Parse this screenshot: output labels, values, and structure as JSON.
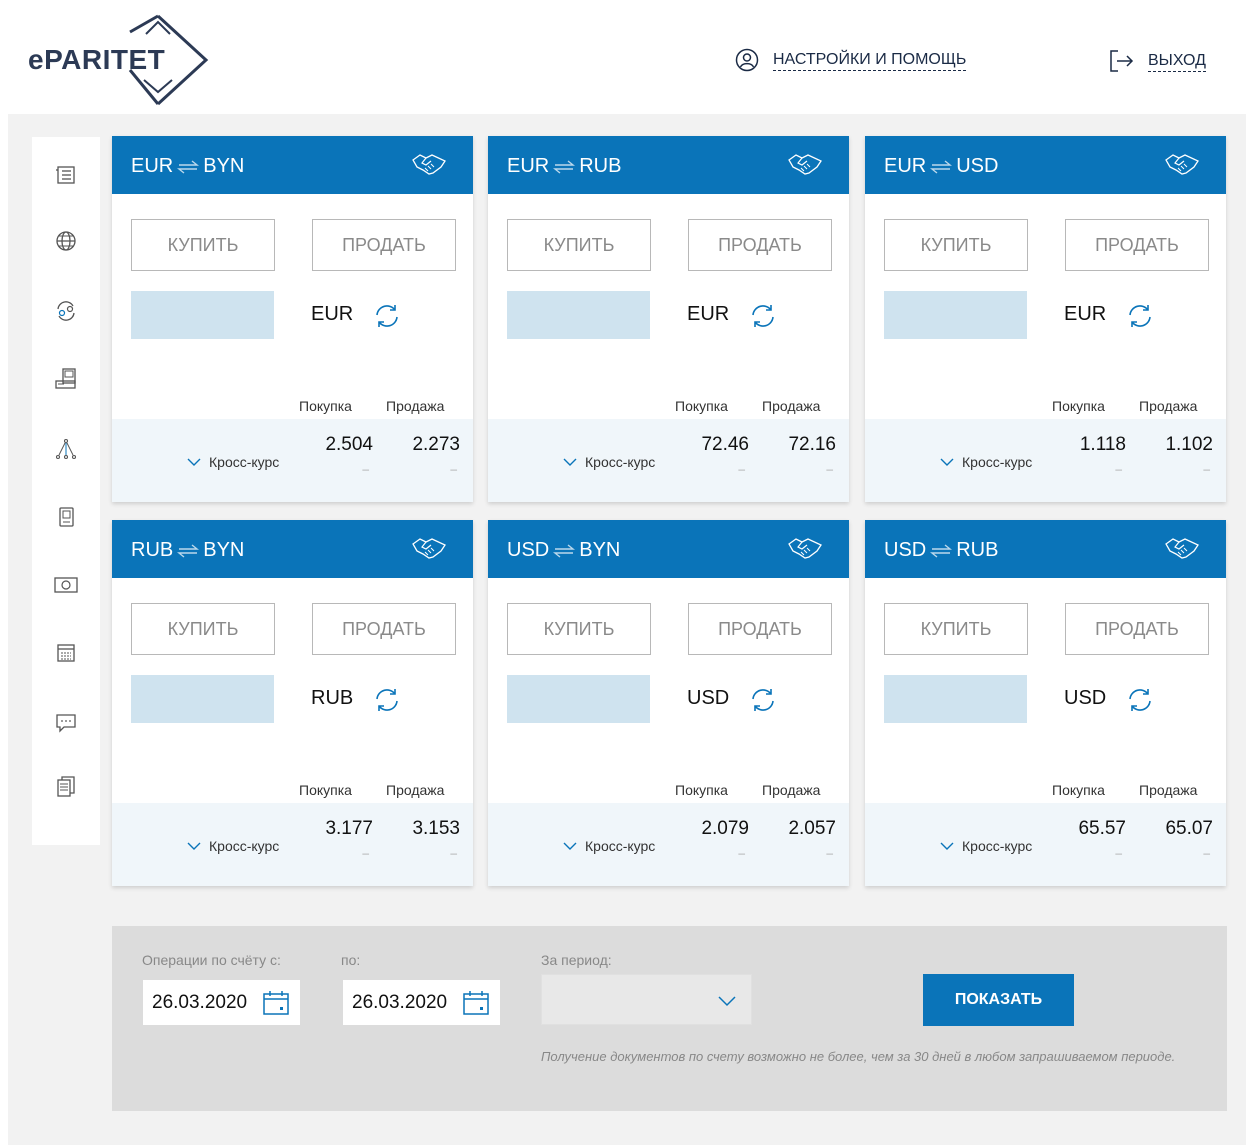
{
  "header": {
    "logo_text": "ePARITET",
    "settings_label": "НАСТРОЙКИ И ПОМОЩЬ",
    "logout_label": "ВЫХОД"
  },
  "sidebar": {
    "items": [
      {
        "icon": "newspaper-icon"
      },
      {
        "icon": "globe-icon"
      },
      {
        "icon": "currency-exchange-icon"
      },
      {
        "icon": "terminal-icon"
      },
      {
        "icon": "network-icon"
      },
      {
        "icon": "document-icon"
      },
      {
        "icon": "banknote-icon"
      },
      {
        "icon": "calendar-grid-icon"
      },
      {
        "icon": "chat-icon"
      },
      {
        "icon": "report-icon"
      }
    ]
  },
  "cards": [
    {
      "from": "EUR",
      "to": "BYN",
      "buy": "КУПИТЬ",
      "sell": "ПРОДАТЬ",
      "currency": "EUR",
      "purchase_label": "Покупка",
      "sale_label": "Продажа",
      "cross_label": "Кросс-курс",
      "purchase_rate": "2.504",
      "sale_rate": "2.273",
      "purchase_dash": "–",
      "sale_dash": "–"
    },
    {
      "from": "EUR",
      "to": "RUB",
      "buy": "КУПИТЬ",
      "sell": "ПРОДАТЬ",
      "currency": "EUR",
      "purchase_label": "Покупка",
      "sale_label": "Продажа",
      "cross_label": "Кросс-курс",
      "purchase_rate": "72.46",
      "sale_rate": "72.16",
      "purchase_dash": "–",
      "sale_dash": "–"
    },
    {
      "from": "EUR",
      "to": "USD",
      "buy": "КУПИТЬ",
      "sell": "ПРОДАТЬ",
      "currency": "EUR",
      "purchase_label": "Покупка",
      "sale_label": "Продажа",
      "cross_label": "Кросс-курс",
      "purchase_rate": "1.118",
      "sale_rate": "1.102",
      "purchase_dash": "–",
      "sale_dash": "–"
    },
    {
      "from": "RUB",
      "to": "BYN",
      "buy": "КУПИТЬ",
      "sell": "ПРОДАТЬ",
      "currency": "RUB",
      "purchase_label": "Покупка",
      "sale_label": "Продажа",
      "cross_label": "Кросс-курс",
      "purchase_rate": "3.177",
      "sale_rate": "3.153",
      "purchase_dash": "–",
      "sale_dash": "–"
    },
    {
      "from": "USD",
      "to": "BYN",
      "buy": "КУПИТЬ",
      "sell": "ПРОДАТЬ",
      "currency": "USD",
      "purchase_label": "Покупка",
      "sale_label": "Продажа",
      "cross_label": "Кросс-курс",
      "purchase_rate": "2.079",
      "sale_rate": "2.057",
      "purchase_dash": "–",
      "sale_dash": "–"
    },
    {
      "from": "USD",
      "to": "RUB",
      "buy": "КУПИТЬ",
      "sell": "ПРОДАТЬ",
      "currency": "USD",
      "purchase_label": "Покупка",
      "sale_label": "Продажа",
      "cross_label": "Кросс-курс",
      "purchase_rate": "65.57",
      "sale_rate": "65.07",
      "purchase_dash": "–",
      "sale_dash": "–"
    }
  ],
  "filter": {
    "from_label": "Операции по счёту с:",
    "to_label": "по:",
    "period_label": "За период:",
    "from_date": "26.03.2020",
    "to_date": "26.03.2020",
    "period_value": "",
    "show_label": "ПОКАЗАТЬ",
    "note": "Получение документов по счету возможно не более, чем за 30 дней в любом запрашиваемом периоде."
  },
  "colors": {
    "accent": "#0a74b9",
    "amount_field": "#cfe3ef",
    "logo": "#2c3a55"
  }
}
